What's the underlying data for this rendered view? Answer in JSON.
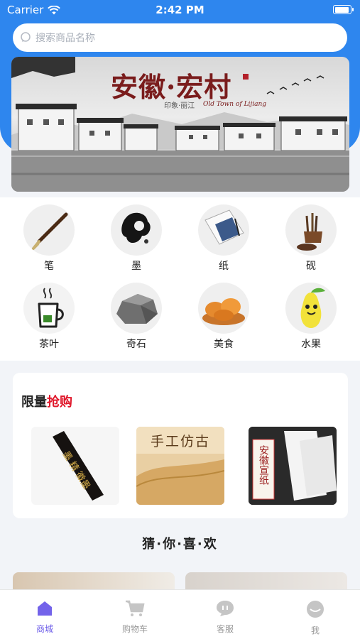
{
  "status_bar": {
    "carrier": "Carrier",
    "time": "2:42 PM"
  },
  "search": {
    "placeholder": "搜索商品名称"
  },
  "banner": {
    "title": "安徽·宏村",
    "subtitle_cn": "印象·丽江",
    "subtitle_en": "Old Town of Lijiang"
  },
  "categories": [
    {
      "label": "笔",
      "icon": "brush-icon"
    },
    {
      "label": "墨",
      "icon": "ink-icon"
    },
    {
      "label": "纸",
      "icon": "paper-icon"
    },
    {
      "label": "砚",
      "icon": "inkstone-icon"
    },
    {
      "label": "茶叶",
      "icon": "tea-icon"
    },
    {
      "label": "奇石",
      "icon": "stone-icon"
    },
    {
      "label": "美食",
      "icon": "food-icon"
    },
    {
      "label": "水果",
      "icon": "fruit-icon"
    }
  ],
  "flash_sale": {
    "title_prefix": "限量",
    "title_highlight": "抢购",
    "products": [
      {
        "label": "墨 精 徽墨 "
      },
      {
        "label": "手工仿古"
      },
      {
        "label": "安徽宣纸"
      }
    ]
  },
  "guess": {
    "title": "猜·你·喜·欢"
  },
  "tabbar": [
    {
      "label": "商城",
      "icon": "home-icon",
      "active": true
    },
    {
      "label": "购物车",
      "icon": "cart-icon",
      "active": false
    },
    {
      "label": "客服",
      "icon": "chat-icon",
      "active": false
    },
    {
      "label": "我",
      "icon": "profile-icon",
      "active": false
    }
  ],
  "colors": {
    "primary": "#2e86ee",
    "accent": "#e0182b",
    "active_tab": "#6b5be8"
  }
}
